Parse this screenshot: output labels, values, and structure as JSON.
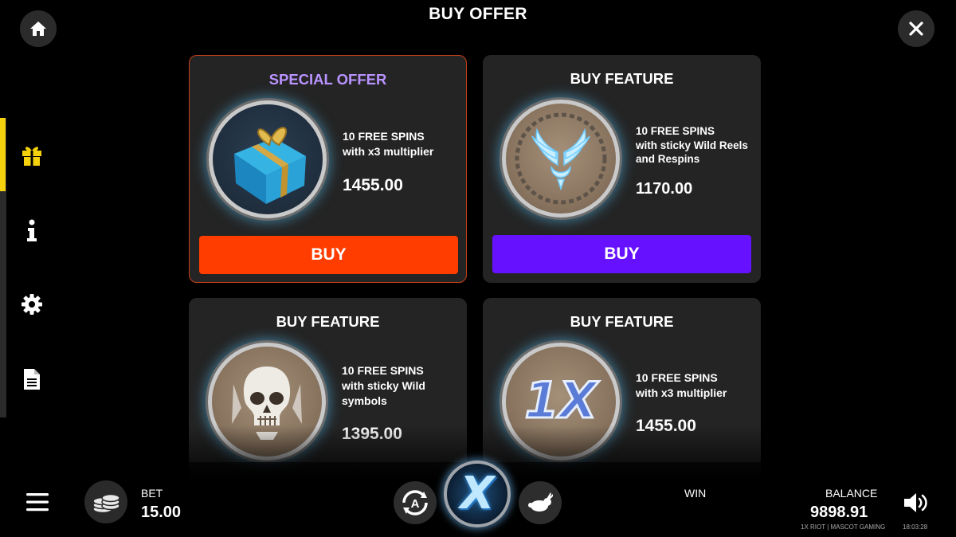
{
  "header": {
    "title": "BUY OFFER"
  },
  "nav": {
    "home_icon": "home-icon",
    "close_icon": "close-icon",
    "side_items": [
      "gift-icon",
      "info-icon",
      "settings-gear-icon",
      "document-icon"
    ],
    "active_color": "#f5d20c"
  },
  "cards": [
    {
      "kind": "special",
      "title": "SPECIAL OFFER",
      "title_color": "#b993ff",
      "icon": "gift-box-icon",
      "desc_lines": [
        "10 FREE SPINS",
        "with x3 multiplier"
      ],
      "price": "1455.00",
      "button_label": "BUY",
      "button_color": "#ff3d00"
    },
    {
      "kind": "feature",
      "title": "BUY FEATURE",
      "icon": "wings-emblem-icon",
      "desc_lines": [
        "10 FREE SPINS",
        "with sticky Wild Reels",
        "and Respins"
      ],
      "price": "1170.00",
      "button_label": "BUY",
      "button_color": "#6611ff"
    },
    {
      "kind": "feature",
      "title": "BUY FEATURE",
      "icon": "skull-icon",
      "desc_lines": [
        "10 FREE SPINS",
        "with sticky Wild",
        "symbols"
      ],
      "price": "1395.00"
    },
    {
      "kind": "feature",
      "title": "BUY FEATURE",
      "icon": "1x-multiplier-icon",
      "icon_text": "1X",
      "desc_lines": [
        "10 FREE SPINS",
        "with x3 multiplier"
      ],
      "price": "1455.00"
    }
  ],
  "bottom": {
    "bet_label": "BET",
    "bet_value": "15.00",
    "win_label": "WIN",
    "balance_label": "BALANCE",
    "balance_value": "9898.91",
    "footer_brand": "1X RIOT | MASCOT GAMING",
    "clock": "18:03:28",
    "spin_letter": "X",
    "autoplay_letter": "A",
    "icons": [
      "menu-icon",
      "coin-stack-icon",
      "autoplay-icon",
      "spin-button-icon",
      "turbo-rabbit-icon",
      "speaker-icon"
    ]
  }
}
